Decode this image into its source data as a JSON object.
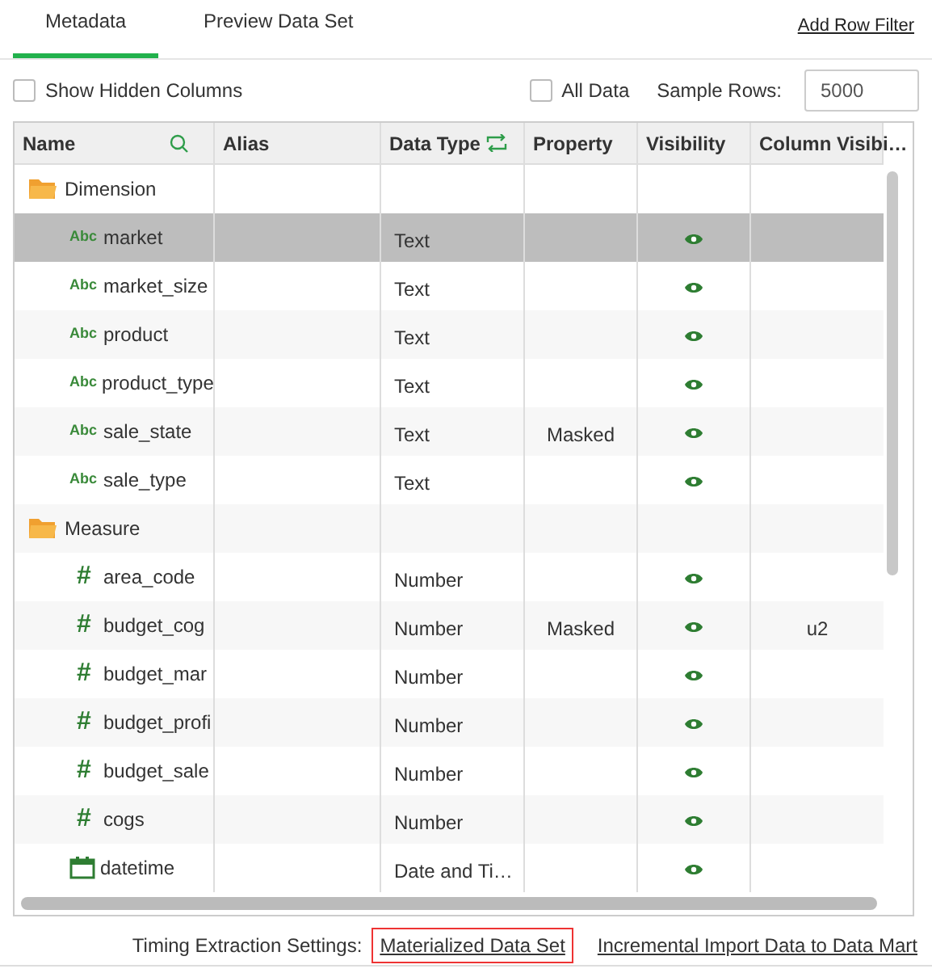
{
  "tabs": [
    {
      "label": "Metadata",
      "selected": true
    },
    {
      "label": "Preview Data Set",
      "selected": false
    }
  ],
  "add_row_filter": "Add Row Filter",
  "options": {
    "show_hidden_columns": {
      "label": "Show Hidden Columns",
      "checked": false
    },
    "all_data": {
      "label": "All Data",
      "checked": false
    },
    "sample_rows_label": "Sample Rows:",
    "sample_rows_value": "5000"
  },
  "table": {
    "columns": [
      "Name",
      "Alias",
      "Data Type",
      "Property",
      "Visibility",
      "Column Visibi…"
    ],
    "rows": [
      {
        "kind": "group",
        "name": "Dimension",
        "selected": false
      },
      {
        "kind": "text",
        "type_icon": "Abc",
        "name": "market",
        "data_type": "Text",
        "property": "",
        "visible": true,
        "column_visibility": "",
        "selected": true
      },
      {
        "kind": "text",
        "type_icon": "Abc",
        "name": "market_size",
        "data_type": "Text",
        "property": "",
        "visible": true,
        "column_visibility": "",
        "selected": false
      },
      {
        "kind": "text",
        "type_icon": "Abc",
        "name": "product",
        "data_type": "Text",
        "property": "",
        "visible": true,
        "column_visibility": "",
        "selected": false
      },
      {
        "kind": "text",
        "type_icon": "Abc",
        "name": "product_type",
        "data_type": "Text",
        "property": "",
        "visible": true,
        "column_visibility": "",
        "selected": false
      },
      {
        "kind": "text",
        "type_icon": "Abc",
        "name": "sale_state",
        "data_type": "Text",
        "property": "Masked",
        "visible": true,
        "column_visibility": "",
        "selected": false
      },
      {
        "kind": "text",
        "type_icon": "Abc",
        "name": "sale_type",
        "data_type": "Text",
        "property": "",
        "visible": true,
        "column_visibility": "",
        "selected": false
      },
      {
        "kind": "group",
        "name": "Measure",
        "selected": false
      },
      {
        "kind": "number",
        "type_icon": "#",
        "name": "area_code",
        "data_type": "Number",
        "property": "",
        "visible": true,
        "column_visibility": "",
        "selected": false
      },
      {
        "kind": "number",
        "type_icon": "#",
        "name": "budget_cog",
        "data_type": "Number",
        "property": "Masked",
        "visible": true,
        "column_visibility": "u2",
        "selected": false
      },
      {
        "kind": "number",
        "type_icon": "#",
        "name": "budget_mar",
        "data_type": "Number",
        "property": "",
        "visible": true,
        "column_visibility": "",
        "selected": false
      },
      {
        "kind": "number",
        "type_icon": "#",
        "name": "budget_profi",
        "data_type": "Number",
        "property": "",
        "visible": true,
        "column_visibility": "",
        "selected": false
      },
      {
        "kind": "number",
        "type_icon": "#",
        "name": "budget_sale",
        "data_type": "Number",
        "property": "",
        "visible": true,
        "column_visibility": "",
        "selected": false
      },
      {
        "kind": "number",
        "type_icon": "#",
        "name": "cogs",
        "data_type": "Number",
        "property": "",
        "visible": true,
        "column_visibility": "",
        "selected": false
      },
      {
        "kind": "date",
        "name": "datetime",
        "data_type": "Date and Ti…",
        "property": "",
        "visible": true,
        "column_visibility": "",
        "selected": false
      }
    ]
  },
  "footer": {
    "label": "Timing Extraction Settings:",
    "links": [
      {
        "label": "Materialized Data Set",
        "selected": true
      },
      {
        "label": "Incremental Import Data to Data Mart",
        "selected": false
      }
    ]
  }
}
